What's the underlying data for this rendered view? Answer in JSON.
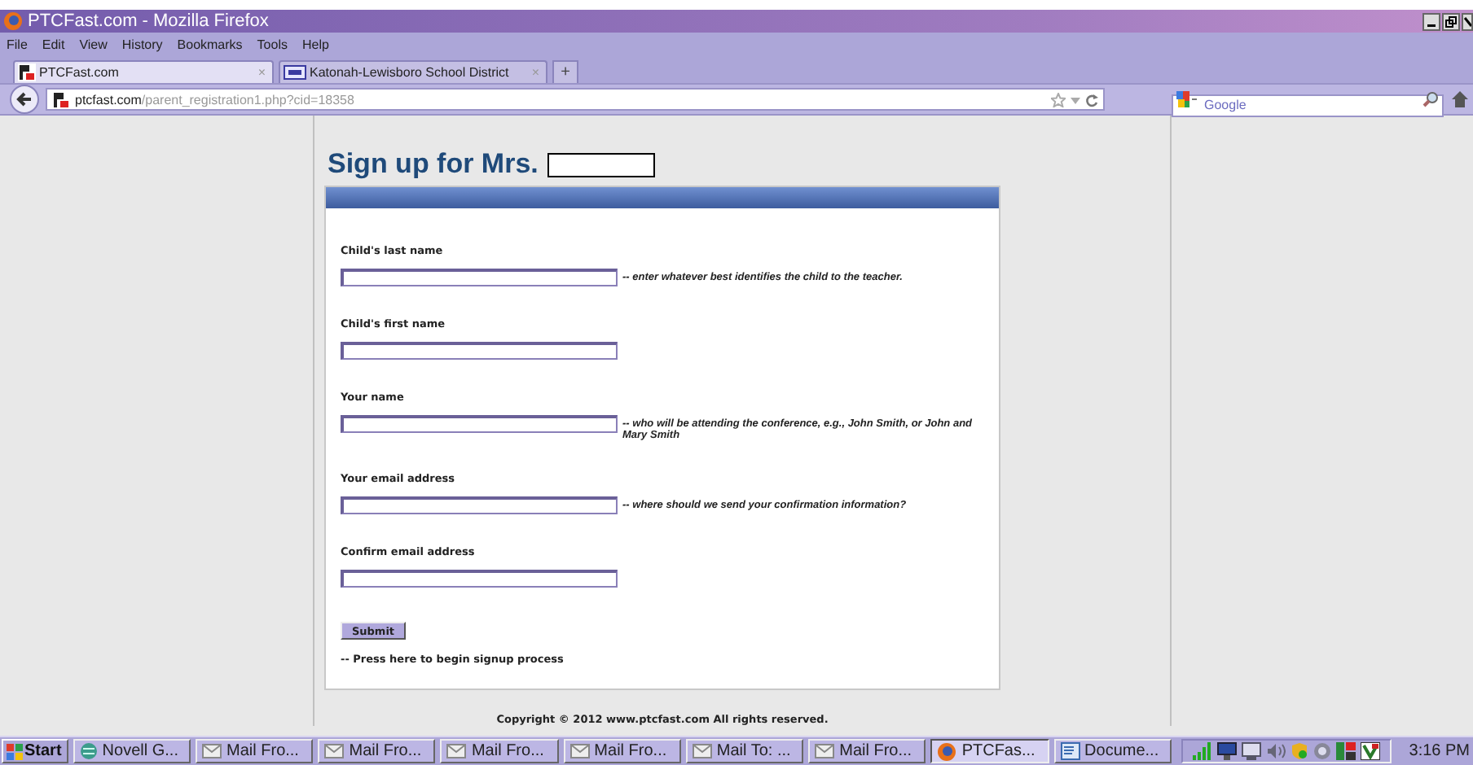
{
  "window": {
    "title": "PTCFast.com - Mozilla Firefox"
  },
  "menu": [
    "File",
    "Edit",
    "View",
    "History",
    "Bookmarks",
    "Tools",
    "Help"
  ],
  "tabs": [
    {
      "label": "PTCFast.com",
      "close": "×",
      "selected": true,
      "kind": "ptc"
    },
    {
      "label": "Katonah-Lewisboro School District",
      "close": "×",
      "selected": false,
      "kind": "school"
    }
  ],
  "new_tab": "+",
  "address": {
    "host": "ptcfast.com",
    "path": "/parent_registration1.php?cid=18358"
  },
  "search": {
    "placeholder": "Google"
  },
  "page": {
    "heading": "Sign up for Mrs.",
    "fields": [
      {
        "label": "Child's last name",
        "hint": "-- enter whatever best identifies the child to the teacher."
      },
      {
        "label": "Child's first name"
      },
      {
        "label": "Your name",
        "hint": "-- who will be attending the conference, e.g., John Smith, or John and Mary Smith"
      },
      {
        "label": "Your email address",
        "hint": "-- where should we send your confirmation information?"
      },
      {
        "label": "Confirm email address"
      }
    ],
    "submit": "Submit",
    "submit_note": "-- Press here to begin signup process",
    "copyright": "Copyright © 2012 www.ptcfast.com All rights reserved."
  },
  "taskbar": {
    "start": "Start",
    "buttons": [
      {
        "label": "Novell G...",
        "kind": "globe",
        "selected": false
      },
      {
        "label": "Mail Fro...",
        "kind": "mail",
        "selected": false
      },
      {
        "label": "Mail Fro...",
        "kind": "mail",
        "selected": false
      },
      {
        "label": "Mail Fro...",
        "kind": "mail",
        "selected": false
      },
      {
        "label": "Mail Fro...",
        "kind": "mail",
        "selected": false
      },
      {
        "label": "Mail To: ...",
        "kind": "mail",
        "selected": false
      },
      {
        "label": "Mail Fro...",
        "kind": "mail",
        "selected": false
      },
      {
        "label": "PTCFas...",
        "kind": "firefox",
        "selected": true
      },
      {
        "label": "Docume...",
        "kind": "document",
        "selected": false
      }
    ],
    "clock": "3:16 PM"
  }
}
